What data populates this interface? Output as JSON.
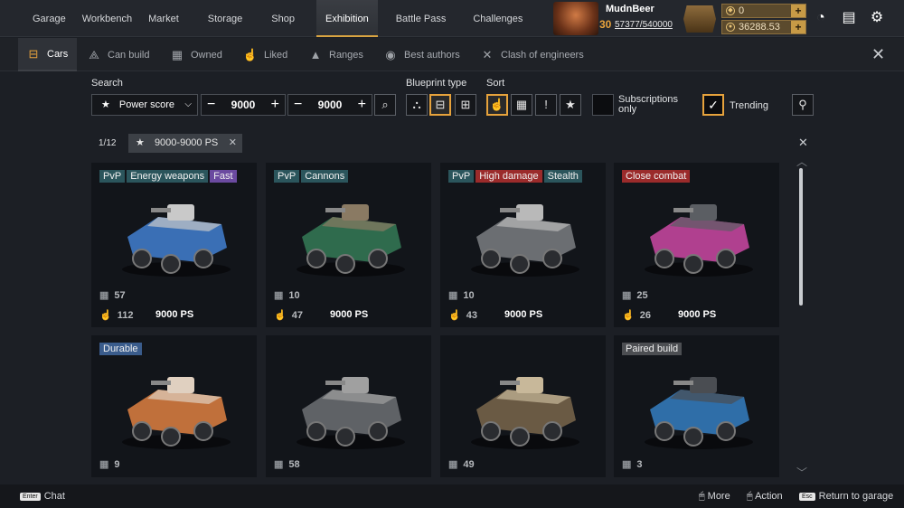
{
  "nav": {
    "items": [
      "Garage",
      "Workbench",
      "Market",
      "Storage",
      "Shop",
      "Exhibition",
      "Battle Pass",
      "Challenges"
    ],
    "active": "Exhibition"
  },
  "profile": {
    "name": "MudnBeer",
    "level": "30",
    "xp": "57377/540000"
  },
  "currency": {
    "coins": "0",
    "balance": "36288.53"
  },
  "tabs": [
    {
      "label": "Cars",
      "icon": "car-icon"
    },
    {
      "label": "Can build",
      "icon": "compass-icon"
    },
    {
      "label": "Owned",
      "icon": "calendar-icon"
    },
    {
      "label": "Liked",
      "icon": "thumbs-up-icon"
    },
    {
      "label": "Ranges",
      "icon": "pyramid-icon"
    },
    {
      "label": "Best authors",
      "icon": "award-icon"
    },
    {
      "label": "Clash of engineers",
      "icon": "crossed-swords-icon"
    }
  ],
  "search": {
    "label": "Search",
    "selected": "Power score",
    "min": "9000",
    "max": "9000"
  },
  "blueprint_type": {
    "label": "Blueprint type"
  },
  "sort": {
    "label": "Sort"
  },
  "subscriptions": {
    "label": "Subscriptions only"
  },
  "trending": {
    "label": "Trending"
  },
  "pagination": {
    "page": "1/12"
  },
  "filter_chip": {
    "label": "9000-9000 PS"
  },
  "cards": [
    {
      "tags": [
        {
          "text": "PvP",
          "color": "teal"
        },
        {
          "text": "Energy weapons",
          "color": "teal"
        },
        {
          "text": "Fast",
          "color": "purple"
        }
      ],
      "builds": "57",
      "likes": "112",
      "ps": "9000 PS",
      "body": "#3a6fb5",
      "accent": "#c9c9c9"
    },
    {
      "tags": [
        {
          "text": "PvP",
          "color": "teal"
        },
        {
          "text": "Cannons",
          "color": "teal"
        }
      ],
      "builds": "10",
      "likes": "47",
      "ps": "9000 PS",
      "body": "#2f6b4d",
      "accent": "#8a7a63"
    },
    {
      "tags": [
        {
          "text": "PvP",
          "color": "teal"
        },
        {
          "text": "High damage",
          "color": "red"
        },
        {
          "text": "Stealth",
          "color": "teal"
        }
      ],
      "builds": "10",
      "likes": "43",
      "ps": "9000 PS",
      "body": "#6b6e72",
      "accent": "#b9b9b9"
    },
    {
      "tags": [
        {
          "text": "Close combat",
          "color": "red"
        }
      ],
      "builds": "25",
      "likes": "26",
      "ps": "9000 PS",
      "body": "#b0408f",
      "accent": "#5b5e63"
    },
    {
      "tags": [
        {
          "text": "Durable",
          "color": "blue"
        }
      ],
      "builds": "9",
      "likes": "",
      "ps": "",
      "body": "#c0703b",
      "accent": "#e0d0c0"
    },
    {
      "tags": [],
      "builds": "58",
      "likes": "",
      "ps": "",
      "body": "#5f6266",
      "accent": "#a0a0a0"
    },
    {
      "tags": [],
      "builds": "49",
      "likes": "",
      "ps": "",
      "body": "#6a5a44",
      "accent": "#c8b89a"
    },
    {
      "tags": [
        {
          "text": "Paired build",
          "color": "gray"
        }
      ],
      "builds": "3",
      "likes": "",
      "ps": "",
      "body": "#2f6ea8",
      "accent": "#4a4d52"
    }
  ],
  "bottom": {
    "chat_key": "Enter",
    "chat": "Chat",
    "more": "More",
    "action": "Action",
    "return_key": "Esc",
    "return": "Return to garage"
  },
  "colors": {
    "accent": "#e6a23c",
    "background": "#1c1f25",
    "card": "#12151a"
  }
}
